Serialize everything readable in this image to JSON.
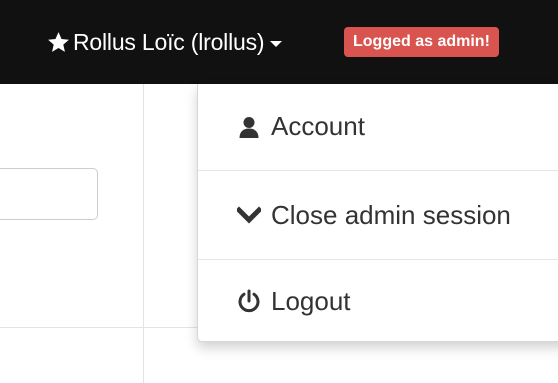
{
  "navbar": {
    "user_label": "Rollus Loïc (lrollus)",
    "user_icon": "star-icon",
    "caret_icon": "caret-down-icon",
    "admin_badge": "Logged as admin!",
    "badge_color": "#d9534f",
    "background_color": "#111111"
  },
  "dropdown": {
    "items": [
      {
        "label": "Account",
        "icon": "user-icon"
      },
      {
        "label": "Close admin session",
        "icon": "chevron-down-icon"
      },
      {
        "label": "Logout",
        "icon": "power-icon"
      }
    ]
  }
}
